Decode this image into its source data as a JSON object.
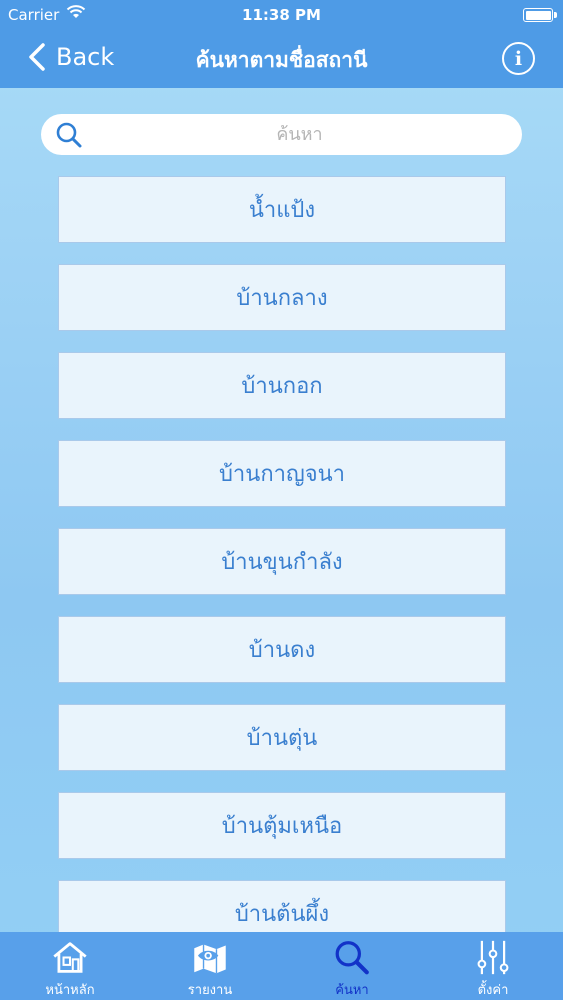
{
  "status_bar": {
    "carrier": "Carrier",
    "time": "11:38 PM"
  },
  "nav": {
    "back_label": "Back",
    "title": "ค้นหาตามชื่อสถานี",
    "info_label": "i"
  },
  "search": {
    "placeholder": "ค้นหา",
    "value": ""
  },
  "stations": [
    "น้ำแป้ง",
    "บ้านกลาง",
    "บ้านกอก",
    "บ้านกาญจนา",
    "บ้านขุนกำลัง",
    "บ้านดง",
    "บ้านตุ่น",
    "บ้านตุ้มเหนือ",
    "บ้านต้นผึ้ง"
  ],
  "tabs": [
    {
      "label": "หน้าหลัก",
      "icon": "home-icon",
      "active": false
    },
    {
      "label": "รายงาน",
      "icon": "map-eye-icon",
      "active": false
    },
    {
      "label": "ค้นหา",
      "icon": "search-icon",
      "active": true
    },
    {
      "label": "ตั้งค่า",
      "icon": "sliders-icon",
      "active": false
    }
  ],
  "colors": {
    "nav_bar": "#4e9be6",
    "tab_bar": "#58a0ea",
    "active_tab": "#1233c8",
    "station_text": "#3a7fcf"
  }
}
